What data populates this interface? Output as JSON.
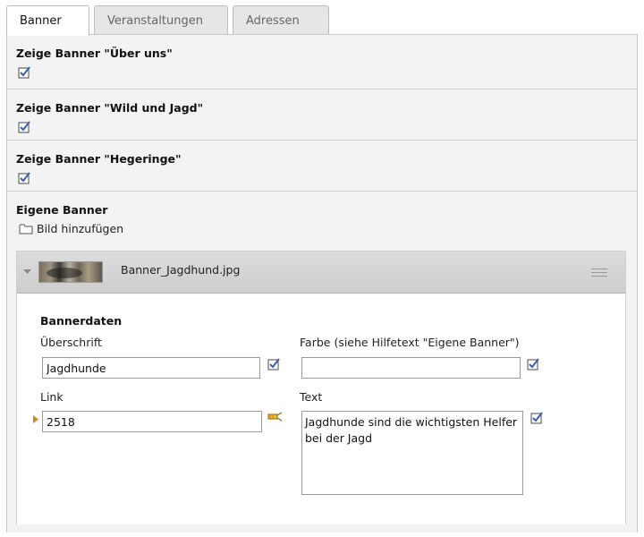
{
  "tabs": [
    {
      "label": "Banner",
      "active": true
    },
    {
      "label": "Veranstaltungen",
      "active": false
    },
    {
      "label": "Adressen",
      "active": false
    }
  ],
  "sections": {
    "ueber_uns": {
      "title": "Zeige Banner \"Über uns\"",
      "checked": true
    },
    "wild_und_jagd": {
      "title": "Zeige Banner \"Wild und Jagd\"",
      "checked": true
    },
    "hegeringe": {
      "title": "Zeige Banner \"Hegeringe\"",
      "checked": true
    },
    "eigene_banner": {
      "title": "Eigene Banner",
      "add_image_label": "Bild hinzufügen"
    }
  },
  "banner_item": {
    "filename": "Banner_Jagdhund.jpg",
    "group_label": "Bannerdaten",
    "fields": {
      "ueberschrift": {
        "label": "Überschrift",
        "value": "Jagdhunde"
      },
      "farbe": {
        "label": "Farbe (siehe Hilfetext \"Eigene Banner\")",
        "value": ""
      },
      "link": {
        "label": "Link",
        "value": "2518"
      },
      "text": {
        "label": "Text",
        "value": "Jagdhunde sind die wichtigsten Helfer bei der Jagd"
      }
    }
  },
  "colors": {
    "checkbox_blue": "#3b5fb0",
    "link_marker": "#d08a1e",
    "panel_bg": "#f2f2f2"
  },
  "icons": {
    "check": "checkbox-checked-icon",
    "folder": "folder-icon",
    "caret": "caret-down-icon",
    "wand": "link-wizard-icon",
    "menu": "drag-handle-icon"
  }
}
